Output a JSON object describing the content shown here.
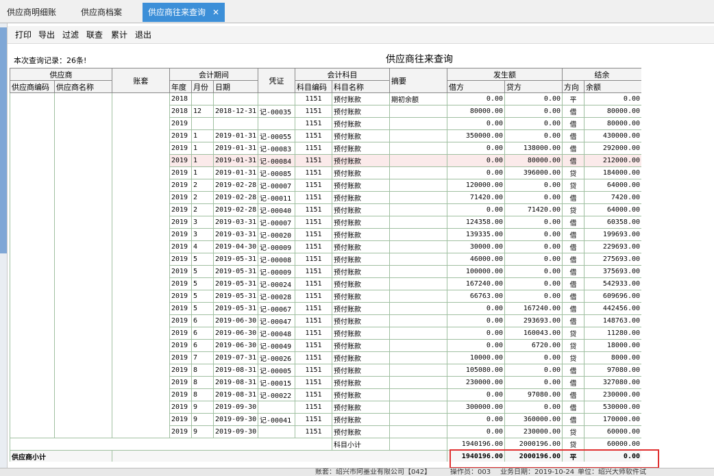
{
  "tabs": [
    {
      "label": "供应商明细账",
      "active": false
    },
    {
      "label": "供应商档案",
      "active": false
    },
    {
      "label": "供应商往来查询",
      "active": true
    }
  ],
  "toolbar": [
    "打印",
    "导出",
    "过滤",
    "联查",
    "累计",
    "退出"
  ],
  "record_count": "本次查询记录：26条!",
  "report_title": "供应商往来查询",
  "headers": {
    "supplier": "供应商",
    "supplier_code": "供应商编码",
    "supplier_name": "供应商名称",
    "account_set": "账套",
    "period": "会计期间",
    "year": "年度",
    "month": "月份",
    "date": "日期",
    "voucher": "凭证",
    "subject": "会计科目",
    "subject_code": "科目编码",
    "subject_name": "科目名称",
    "summary": "摘要",
    "amount": "发生额",
    "debit": "借方",
    "credit": "贷方",
    "balance_group": "结余",
    "direction": "方向",
    "balance": "余额"
  },
  "rows": [
    {
      "year": "2018",
      "month": "",
      "date": "",
      "voucher": "",
      "code": "1151",
      "name": "预付账款",
      "summary": "期初余额",
      "debit": "0.00",
      "credit": "0.00",
      "dir": "平",
      "bal": "0.00"
    },
    {
      "year": "2018",
      "month": "12",
      "date": "2018-12-31",
      "voucher": "记-00035",
      "code": "1151",
      "name": "预付账款",
      "summary": "",
      "debit": "80000.00",
      "credit": "0.00",
      "dir": "借",
      "bal": "80000.00"
    },
    {
      "year": "2019",
      "month": "",
      "date": "",
      "voucher": "",
      "code": "1151",
      "name": "预付账款",
      "summary": "",
      "debit": "0.00",
      "credit": "0.00",
      "dir": "借",
      "bal": "80000.00"
    },
    {
      "year": "2019",
      "month": "1",
      "date": "2019-01-31",
      "voucher": "记-00055",
      "code": "1151",
      "name": "预付账款",
      "summary": "",
      "debit": "350000.00",
      "credit": "0.00",
      "dir": "借",
      "bal": "430000.00"
    },
    {
      "year": "2019",
      "month": "1",
      "date": "2019-01-31",
      "voucher": "记-00083",
      "code": "1151",
      "name": "预付账款",
      "summary": "",
      "debit": "0.00",
      "credit": "138000.00",
      "dir": "借",
      "bal": "292000.00"
    },
    {
      "year": "2019",
      "month": "1",
      "date": "2019-01-31",
      "voucher": "记-00084",
      "code": "1151",
      "name": "预付账款",
      "summary": "",
      "debit": "0.00",
      "credit": "80000.00",
      "dir": "借",
      "bal": "212000.00",
      "hl": true
    },
    {
      "year": "2019",
      "month": "1",
      "date": "2019-01-31",
      "voucher": "记-00085",
      "code": "1151",
      "name": "预付账款",
      "summary": "",
      "debit": "0.00",
      "credit": "396000.00",
      "dir": "贷",
      "bal": "184000.00"
    },
    {
      "year": "2019",
      "month": "2",
      "date": "2019-02-28",
      "voucher": "记-00007",
      "code": "1151",
      "name": "预付账款",
      "summary": "",
      "debit": "120000.00",
      "credit": "0.00",
      "dir": "贷",
      "bal": "64000.00"
    },
    {
      "year": "2019",
      "month": "2",
      "date": "2019-02-28",
      "voucher": "记-00011",
      "code": "1151",
      "name": "预付账款",
      "summary": "",
      "debit": "71420.00",
      "credit": "0.00",
      "dir": "借",
      "bal": "7420.00"
    },
    {
      "year": "2019",
      "month": "2",
      "date": "2019-02-28",
      "voucher": "记-00040",
      "code": "1151",
      "name": "预付账款",
      "summary": "",
      "debit": "0.00",
      "credit": "71420.00",
      "dir": "贷",
      "bal": "64000.00"
    },
    {
      "year": "2019",
      "month": "3",
      "date": "2019-03-31",
      "voucher": "记-00007",
      "code": "1151",
      "name": "预付账款",
      "summary": "",
      "debit": "124358.00",
      "credit": "0.00",
      "dir": "借",
      "bal": "60358.00"
    },
    {
      "year": "2019",
      "month": "3",
      "date": "2019-03-31",
      "voucher": "记-00020",
      "code": "1151",
      "name": "预付账款",
      "summary": "",
      "debit": "139335.00",
      "credit": "0.00",
      "dir": "借",
      "bal": "199693.00"
    },
    {
      "year": "2019",
      "month": "4",
      "date": "2019-04-30",
      "voucher": "记-00009",
      "code": "1151",
      "name": "预付账款",
      "summary": "",
      "debit": "30000.00",
      "credit": "0.00",
      "dir": "借",
      "bal": "229693.00"
    },
    {
      "year": "2019",
      "month": "5",
      "date": "2019-05-31",
      "voucher": "记-00008",
      "code": "1151",
      "name": "预付账款",
      "summary": "",
      "debit": "46000.00",
      "credit": "0.00",
      "dir": "借",
      "bal": "275693.00"
    },
    {
      "year": "2019",
      "month": "5",
      "date": "2019-05-31",
      "voucher": "记-00009",
      "code": "1151",
      "name": "预付账款",
      "summary": "",
      "debit": "100000.00",
      "credit": "0.00",
      "dir": "借",
      "bal": "375693.00"
    },
    {
      "year": "2019",
      "month": "5",
      "date": "2019-05-31",
      "voucher": "记-00024",
      "code": "1151",
      "name": "预付账款",
      "summary": "",
      "debit": "167240.00",
      "credit": "0.00",
      "dir": "借",
      "bal": "542933.00"
    },
    {
      "year": "2019",
      "month": "5",
      "date": "2019-05-31",
      "voucher": "记-00028",
      "code": "1151",
      "name": "预付账款",
      "summary": "",
      "debit": "66763.00",
      "credit": "0.00",
      "dir": "借",
      "bal": "609696.00"
    },
    {
      "year": "2019",
      "month": "5",
      "date": "2019-05-31",
      "voucher": "记-00067",
      "code": "1151",
      "name": "预付账款",
      "summary": "",
      "debit": "0.00",
      "credit": "167240.00",
      "dir": "借",
      "bal": "442456.00"
    },
    {
      "year": "2019",
      "month": "6",
      "date": "2019-06-30",
      "voucher": "记-00047",
      "code": "1151",
      "name": "预付账款",
      "summary": "",
      "debit": "0.00",
      "credit": "293693.00",
      "dir": "借",
      "bal": "148763.00"
    },
    {
      "year": "2019",
      "month": "6",
      "date": "2019-06-30",
      "voucher": "记-00048",
      "code": "1151",
      "name": "预付账款",
      "summary": "",
      "debit": "0.00",
      "credit": "160043.00",
      "dir": "贷",
      "bal": "11280.00"
    },
    {
      "year": "2019",
      "month": "6",
      "date": "2019-06-30",
      "voucher": "记-00049",
      "code": "1151",
      "name": "预付账款",
      "summary": "",
      "debit": "0.00",
      "credit": "6720.00",
      "dir": "贷",
      "bal": "18000.00"
    },
    {
      "year": "2019",
      "month": "7",
      "date": "2019-07-31",
      "voucher": "记-00026",
      "code": "1151",
      "name": "预付账款",
      "summary": "",
      "debit": "10000.00",
      "credit": "0.00",
      "dir": "贷",
      "bal": "8000.00"
    },
    {
      "year": "2019",
      "month": "8",
      "date": "2019-08-31",
      "voucher": "记-00005",
      "code": "1151",
      "name": "预付账款",
      "summary": "",
      "debit": "105080.00",
      "credit": "0.00",
      "dir": "借",
      "bal": "97080.00"
    },
    {
      "year": "2019",
      "month": "8",
      "date": "2019-08-31",
      "voucher": "记-00015",
      "code": "1151",
      "name": "预付账款",
      "summary": "",
      "debit": "230000.00",
      "credit": "0.00",
      "dir": "借",
      "bal": "327080.00"
    },
    {
      "year": "2019",
      "month": "8",
      "date": "2019-08-31",
      "voucher": "记-00022",
      "code": "1151",
      "name": "预付账款",
      "summary": "",
      "debit": "0.00",
      "credit": "97080.00",
      "dir": "借",
      "bal": "230000.00"
    },
    {
      "year": "2019",
      "month": "9",
      "date": "2019-09-30",
      "voucher": "",
      "code": "1151",
      "name": "预付账款",
      "summary": "",
      "debit": "300000.00",
      "credit": "0.00",
      "dir": "借",
      "bal": "530000.00"
    },
    {
      "year": "2019",
      "month": "9",
      "date": "2019-09-30",
      "voucher": "记-00041",
      "code": "1151",
      "name": "预付账款",
      "summary": "",
      "debit": "0.00",
      "credit": "360000.00",
      "dir": "借",
      "bal": "170000.00"
    },
    {
      "year": "2019",
      "month": "9",
      "date": "2019-09-30",
      "voucher": "",
      "code": "1151",
      "name": "预付账款",
      "summary": "",
      "debit": "0.00",
      "credit": "230000.00",
      "dir": "贷",
      "bal": "60000.00"
    }
  ],
  "subject_subtotal": {
    "label": "科目小计",
    "debit": "1940196.00",
    "credit": "2000196.00",
    "dir": "贷",
    "bal": "60000.00"
  },
  "supplier_subtotal": {
    "label": "供应商小计",
    "debit": "1940196.00",
    "credit": "2000196.00",
    "dir": "平",
    "bal": "0.00"
  },
  "status": {
    "account": "账套：绍兴市阿墨业有限公司【042】",
    "operator": "操作员：003",
    "biz_date": "业务日期：2019-10-24",
    "unit": "单位：绍兴大师软件试"
  }
}
